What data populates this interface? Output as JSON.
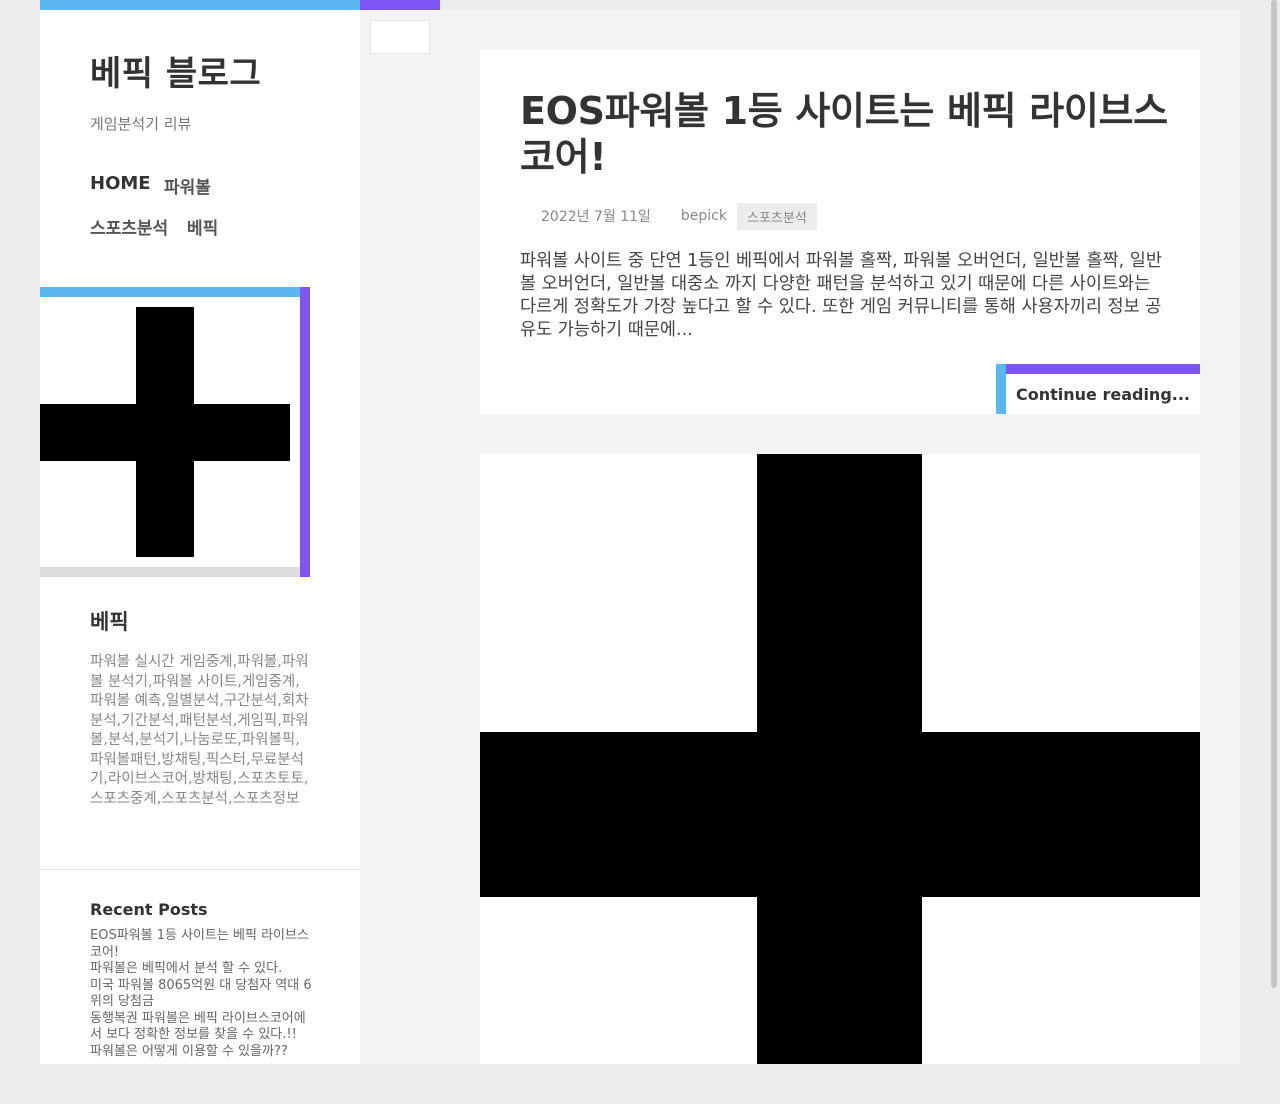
{
  "site": {
    "title": "베픽 블로그",
    "description": "게임분석기 리뷰"
  },
  "nav": {
    "items": [
      "HOME",
      "파워볼",
      "스포츠분석",
      "베픽"
    ]
  },
  "widget": {
    "title": "베픽",
    "text": "파워볼 실시간 게임중계,파워볼,파워볼 분석기,파워볼 사이트,게임중계,파워볼 예측,일별분석,구간분석,회차분석,기간분석,패턴분석,게임픽,파워볼,분석,분석기,나눔로또,파워볼픽,파워볼패턴,방채팅,픽스터,무료분석기,라이브스코어,방채팅,스포츠토토,스포츠중계,스포츠분석,스포츠정보"
  },
  "recent_posts": {
    "title": "Recent Posts",
    "items": [
      "EOS파워볼 1등 사이트는 베픽 라이브스코어!",
      "파워볼은 베픽에서 분석 할 수 있다.",
      "미국 파워볼 8065억원 대 당첨자 역대 6위의 당첨금",
      "동행복권 파워볼은 베픽 라이브스코어에서 보다 정확한 정보를 찾을 수 있다.!!",
      "파워볼은 어떻게 이용할 수 있을까??"
    ]
  },
  "post": {
    "title": "EOS파워볼 1등 사이트는 베픽 라이브스코어!",
    "date": "2022년 7월 11일",
    "author": "bepick",
    "category": "스포츠분석",
    "excerpt": "파워볼 사이트 중 단연 1등인 베픽에서 파워볼 홀짝, 파워볼 오버언더, 일반볼 홀짝, 일반볼 오버언더, 일반볼 대중소 까지 다양한 패턴을 분석하고 있기 때문에 다른 사이트와는 다르게 정확도가 가장 높다고 할 수 있다. 또한 게임 커뮤니티를 통해 사용자끼리 정보 공유도 가능하기 때문에...",
    "continue_label": "Continue reading..."
  },
  "colors": {
    "accent_blue": "#5bb7ef",
    "accent_purple": "#7e55f2"
  }
}
